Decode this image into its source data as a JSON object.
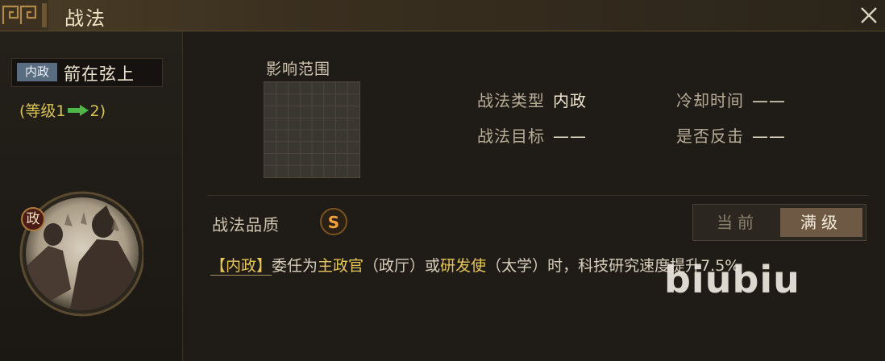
{
  "window": {
    "title": "战法",
    "close_icon": "close-icon"
  },
  "skill": {
    "tag": "内政",
    "name": "箭在弦上",
    "level_prefix": "(等级1",
    "level_suffix": "2)",
    "portrait_badge": "政"
  },
  "range": {
    "label": "影响范围"
  },
  "info": {
    "type_label": "战法类型",
    "type_value": "内政",
    "cooldown_label": "冷却时间",
    "cooldown_value": "——",
    "target_label": "战法目标",
    "target_value": "——",
    "counter_label": "是否反击",
    "counter_value": "——"
  },
  "quality": {
    "label": "战法品质",
    "grade": "S"
  },
  "toggle": {
    "current": "当前",
    "max": "满级"
  },
  "description": {
    "tag": "【内政】",
    "p1": "委任为",
    "hl1": "主政官",
    "p2": "（政厅）或",
    "hl2": "研发使",
    "p3": "（太学）时，科技研究速度提升7.5%"
  },
  "watermark": "biubiu",
  "colors": {
    "accent_gold": "#e6c65a",
    "level_green": "#4cb84a",
    "badge_orange": "#f1a23b"
  }
}
